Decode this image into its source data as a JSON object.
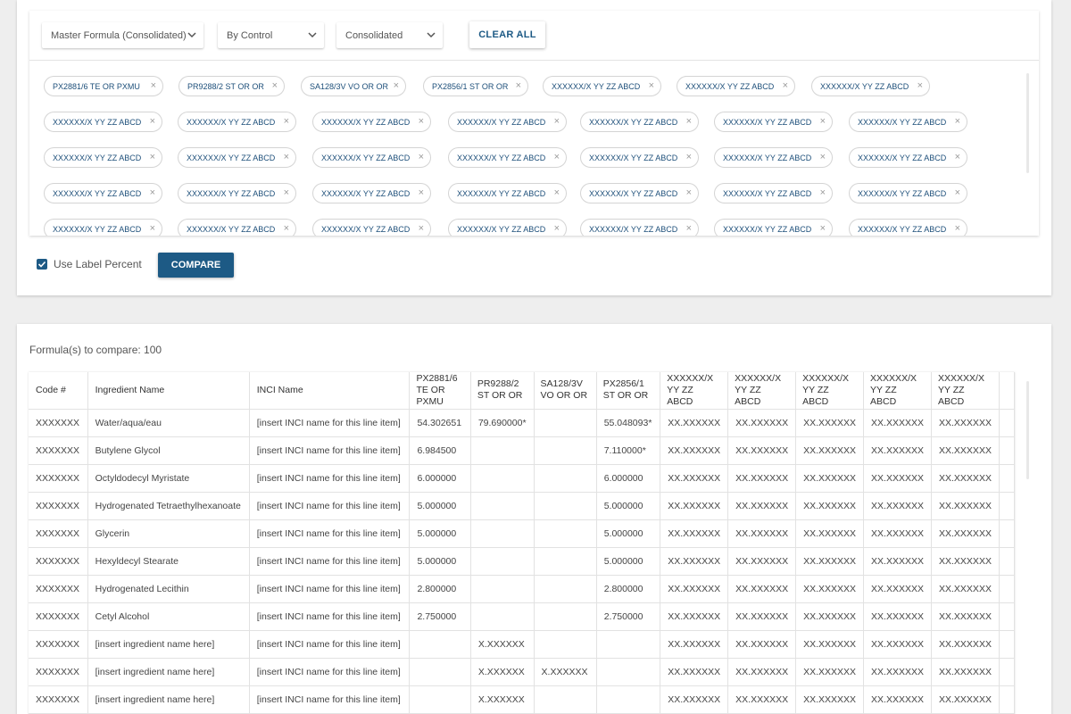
{
  "filters": {
    "formula_select": "Master Formula (Consolidated)",
    "control_select": "By Control",
    "consolidated_select": "Consolidated",
    "clear_all": "CLEAR ALL"
  },
  "chips": [
    "PX2881/6 TE OR PXMU",
    "PR9288/2 ST OR OR",
    "SA128/3V VO OR OR",
    "PX2856/1 ST OR OR",
    "XXXXXX/X YY ZZ ABCD",
    "XXXXXX/X YY ZZ ABCD",
    "XXXXXX/X YY ZZ ABCD",
    "XXXXXX/X YY ZZ ABCD",
    "XXXXXX/X YY ZZ ABCD",
    "XXXXXX/X YY ZZ ABCD",
    "XXXXXX/X YY ZZ ABCD",
    "XXXXXX/X YY ZZ ABCD",
    "XXXXXX/X YY ZZ ABCD",
    "XXXXXX/X YY ZZ ABCD",
    "XXXXXX/X YY ZZ ABCD",
    "XXXXXX/X YY ZZ ABCD",
    "XXXXXX/X YY ZZ ABCD",
    "XXXXXX/X YY ZZ ABCD",
    "XXXXXX/X YY ZZ ABCD",
    "XXXXXX/X YY ZZ ABCD",
    "XXXXXX/X YY ZZ ABCD",
    "XXXXXX/X YY ZZ ABCD",
    "XXXXXX/X YY ZZ ABCD",
    "XXXXXX/X YY ZZ ABCD",
    "XXXXXX/X YY ZZ ABCD",
    "XXXXXX/X YY ZZ ABCD",
    "XXXXXX/X YY ZZ ABCD",
    "XXXXXX/X YY ZZ ABCD",
    "XXXXXX/X YY ZZ ABCD",
    "XXXXXX/X YY ZZ ABCD",
    "XXXXXX/X YY ZZ ABCD",
    "XXXXXX/X YY ZZ ABCD",
    "XXXXXX/X YY ZZ ABCD",
    "XXXXXX/X YY ZZ ABCD",
    "XXXXXX/X YY ZZ ABCD"
  ],
  "options": {
    "use_label_percent": "Use Label Percent",
    "use_label_percent_checked": true,
    "compare": "COMPARE"
  },
  "results": {
    "count_label": "Formula(s) to compare: 100",
    "headers": [
      [
        "Code #"
      ],
      [
        "Ingredient Name"
      ],
      [
        "INCI Name"
      ],
      [
        "PX2881/6",
        "TE OR PXMU"
      ],
      [
        "PR9288/2",
        "ST OR OR"
      ],
      [
        "SA128/3V",
        "VO OR OR"
      ],
      [
        "PX2856/1",
        "ST OR OR"
      ],
      [
        "XXXXXX/X",
        "YY ZZ ABCD"
      ],
      [
        "XXXXXX/X",
        "YY ZZ ABCD"
      ],
      [
        "XXXXXX/X",
        "YY ZZ ABCD"
      ],
      [
        "XXXXXX/X",
        "YY ZZ ABCD"
      ],
      [
        "XXXXXX/X",
        "YY ZZ ABCD"
      ]
    ],
    "rows": [
      [
        "XXXXXXX",
        "Water/aqua/eau",
        "[insert INCI name for this line item]",
        "54.302651",
        "79.690000*",
        "",
        "55.048093*",
        "XX.XXXXXX",
        "XX.XXXXXX",
        "XX.XXXXXX",
        "XX.XXXXXX",
        "XX.XXXXXX"
      ],
      [
        "XXXXXXX",
        "Butylene Glycol",
        "[insert INCI name for this line item]",
        "6.984500",
        "",
        "",
        "7.110000*",
        "XX.XXXXXX",
        "XX.XXXXXX",
        "XX.XXXXXX",
        "XX.XXXXXX",
        "XX.XXXXXX"
      ],
      [
        "XXXXXXX",
        "Octyldodecyl Myristate",
        "[insert INCI name for this line item]",
        "6.000000",
        "",
        "",
        "6.000000",
        "XX.XXXXXX",
        "XX.XXXXXX",
        "XX.XXXXXX",
        "XX.XXXXXX",
        "XX.XXXXXX"
      ],
      [
        "XXXXXXX",
        "Hydrogenated Tetraethylhexanoate",
        "[insert INCI name for this line item]",
        "5.000000",
        "",
        "",
        "5.000000",
        "XX.XXXXXX",
        "XX.XXXXXX",
        "XX.XXXXXX",
        "XX.XXXXXX",
        "XX.XXXXXX"
      ],
      [
        "XXXXXXX",
        "Glycerin",
        "[insert INCI name for this line item]",
        "5.000000",
        "",
        "",
        "5.000000",
        "XX.XXXXXX",
        "XX.XXXXXX",
        "XX.XXXXXX",
        "XX.XXXXXX",
        "XX.XXXXXX"
      ],
      [
        "XXXXXXX",
        "Hexyldecyl Stearate",
        "[insert INCI name for this line item]",
        "5.000000",
        "",
        "",
        "5.000000",
        "XX.XXXXXX",
        "XX.XXXXXX",
        "XX.XXXXXX",
        "XX.XXXXXX",
        "XX.XXXXXX"
      ],
      [
        "XXXXXXX",
        "Hydrogenated Lecithin",
        "[insert INCI name for this line item]",
        "2.800000",
        "",
        "",
        "2.800000",
        "XX.XXXXXX",
        "XX.XXXXXX",
        "XX.XXXXXX",
        "XX.XXXXXX",
        "XX.XXXXXX"
      ],
      [
        "XXXXXXX",
        "Cetyl Alcohol",
        "[insert INCI name for this line item]",
        "2.750000",
        "",
        "",
        "2.750000",
        "XX.XXXXXX",
        "XX.XXXXXX",
        "XX.XXXXXX",
        "XX.XXXXXX",
        "XX.XXXXXX"
      ],
      [
        "XXXXXXX",
        "[insert ingredient name here]",
        "[insert INCI name for this line item]",
        "",
        "X.XXXXXX",
        "",
        "",
        "XX.XXXXXX",
        "XX.XXXXXX",
        "XX.XXXXXX",
        "XX.XXXXXX",
        "XX.XXXXXX"
      ],
      [
        "XXXXXXX",
        "[insert ingredient name here]",
        "[insert INCI name for this line item]",
        "",
        "X.XXXXXX",
        "X.XXXXXX",
        "",
        "XX.XXXXXX",
        "XX.XXXXXX",
        "XX.XXXXXX",
        "XX.XXXXXX",
        "XX.XXXXXX"
      ],
      [
        "XXXXXXX",
        "[insert ingredient name here]",
        "[insert INCI name for this line item]",
        "",
        "X.XXXXXX",
        "",
        "",
        "XX.XXXXXX",
        "XX.XXXXXX",
        "XX.XXXXXX",
        "XX.XXXXXX",
        "XX.XXXXXX"
      ]
    ]
  },
  "icons": {
    "dropdown": "chevron-down-icon",
    "chip_remove": "close-icon",
    "checkbox": "check-icon"
  },
  "colors": {
    "primary": "#1d5a85",
    "chip_text": "#1d4f7a",
    "background": "#eeeeee"
  }
}
